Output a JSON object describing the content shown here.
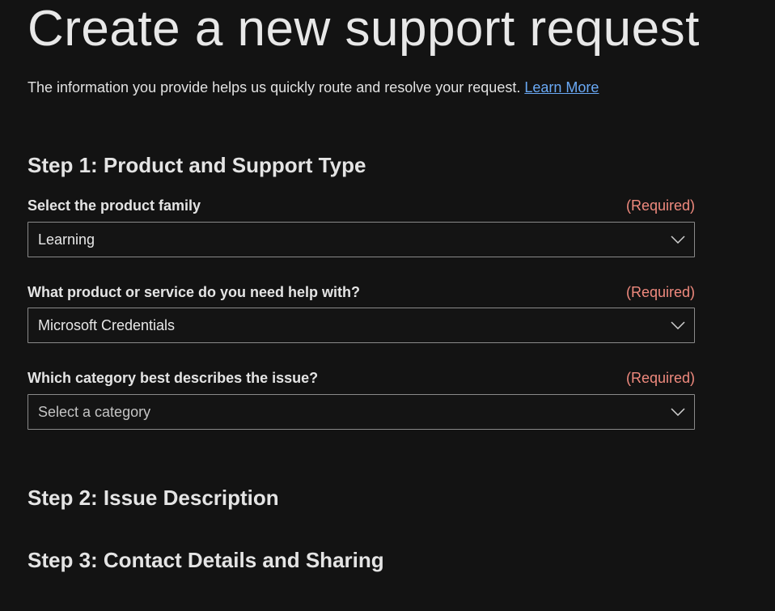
{
  "page": {
    "title": "Create a new support request",
    "intro": "The information you provide helps us quickly route and resolve your request.",
    "learn_more": "Learn More"
  },
  "steps": {
    "step1": {
      "heading": "Step 1: Product and Support Type",
      "fields": [
        {
          "label": "Select the product family",
          "required": "(Required)",
          "value": "Learning",
          "icon": "chevron-down-icon"
        },
        {
          "label": "What product or service do you need help with?",
          "required": "(Required)",
          "value": "Microsoft Credentials",
          "icon": "chevron-down-icon"
        },
        {
          "label": "Which category best describes the issue?",
          "required": "(Required)",
          "value": "Select a category",
          "icon": "chevron-down-icon"
        }
      ]
    },
    "step2": {
      "heading": "Step 2: Issue Description"
    },
    "step3": {
      "heading": "Step 3: Contact Details and Sharing"
    }
  },
  "colors": {
    "background": "#131313",
    "link": "#6aa9f5",
    "required": "#f08a7e",
    "border": "#8a8a8a"
  }
}
